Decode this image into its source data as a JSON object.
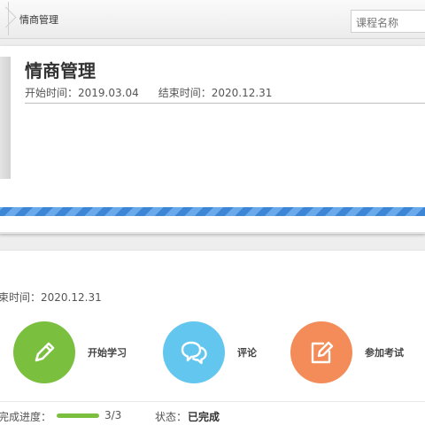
{
  "breadcrumb": {
    "title": "情商管理"
  },
  "search": {
    "placeholder": "课程名称"
  },
  "course": {
    "title": "情商管理",
    "start_time": "开始时间：2019.03.04",
    "end_time": "结束时间：2020.12.31"
  },
  "detail": {
    "end_time": "束时间：2020.12.31",
    "actions": [
      {
        "label": "开始学习",
        "icon": "pencil-icon",
        "color": "#7bbf3f"
      },
      {
        "label": "评论",
        "icon": "speech-bubbles-icon",
        "color": "#63c6ee"
      },
      {
        "label": "参加考试",
        "icon": "edit-document-icon",
        "color": "#f38c59"
      }
    ],
    "progress_label": "完成进度：",
    "progress_count": "3/3",
    "progress_fraction": 1.0,
    "status_label": "状态：",
    "status_value": "已完成"
  }
}
